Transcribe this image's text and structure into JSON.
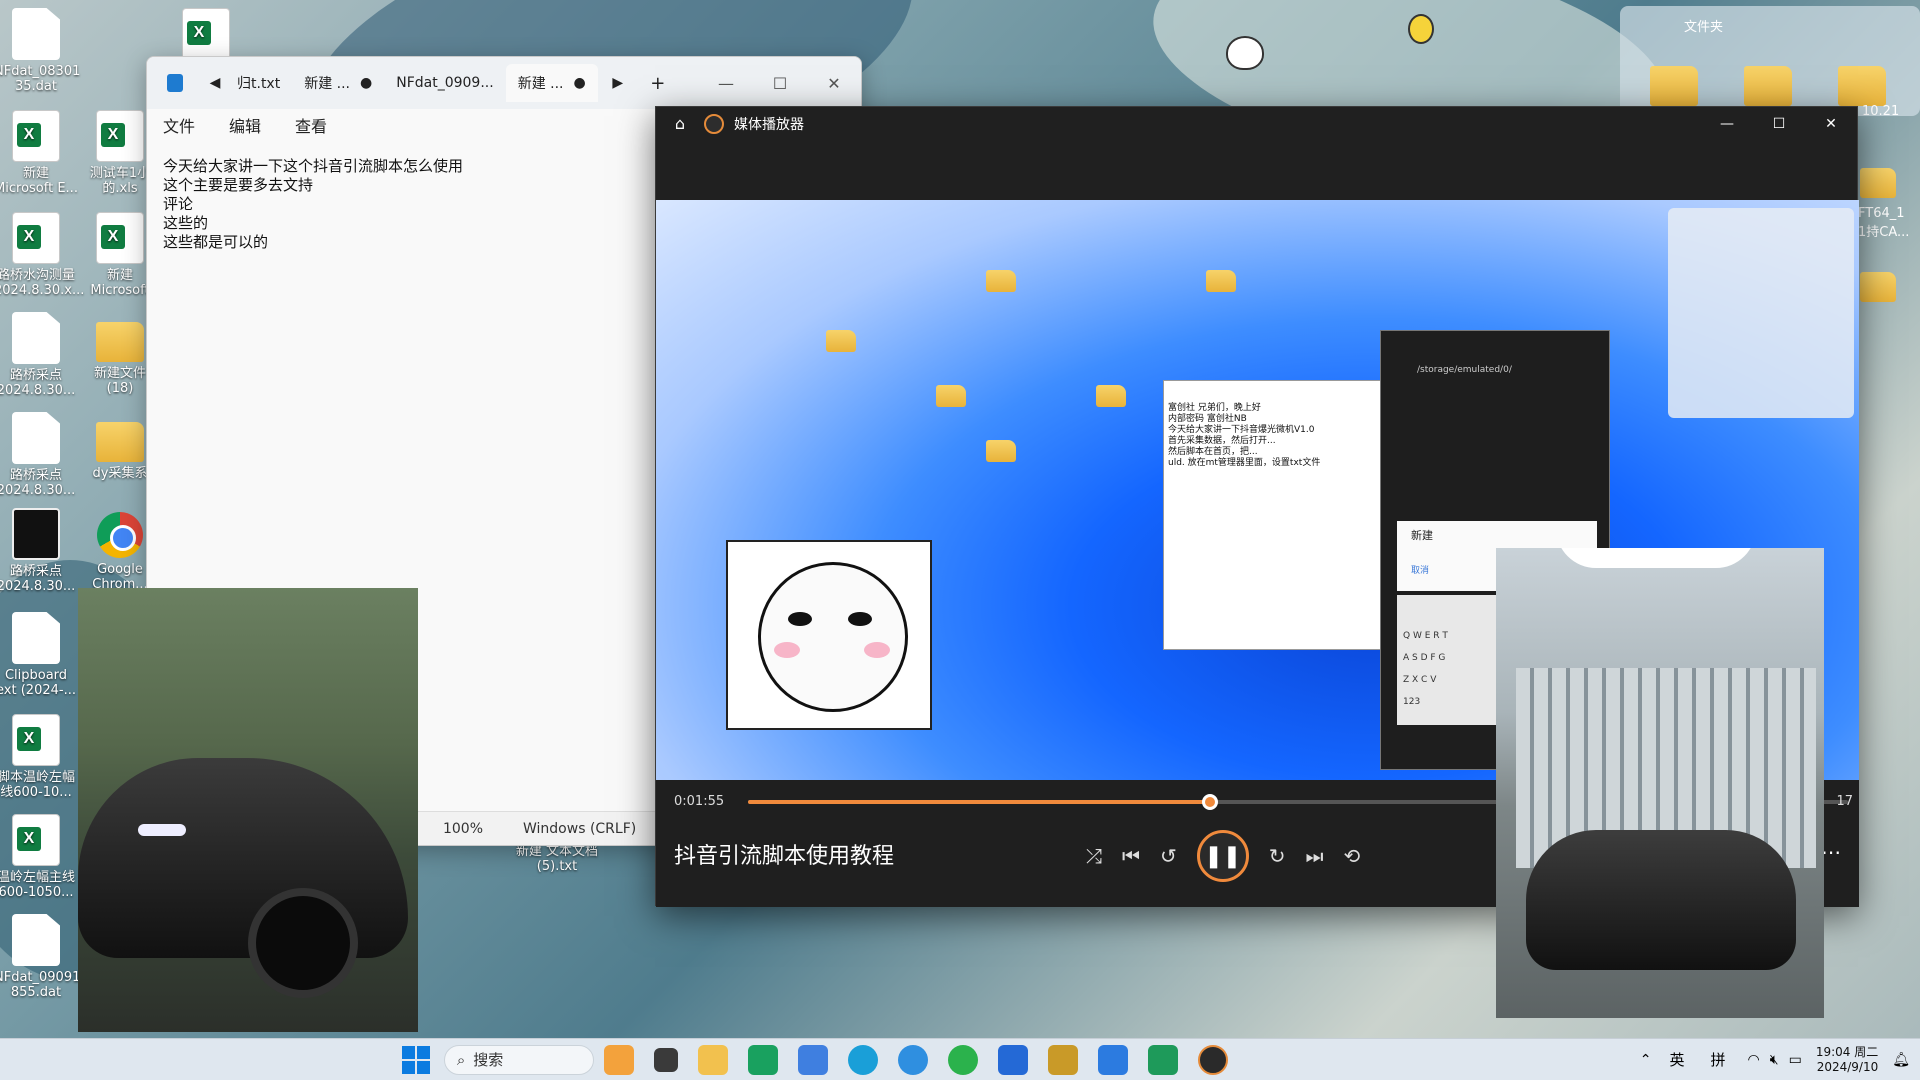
{
  "desktop": {
    "icons": [
      {
        "label": "NFdat_08301\n35.dat",
        "type": "file"
      },
      {
        "label": "新建\nMicrosoft E...",
        "type": "excel"
      },
      {
        "label": "测试车1小\n的.xls",
        "type": "excel"
      },
      {
        "label": "路桥水沟测量\n2024.8.30.x...",
        "type": "excel"
      },
      {
        "label": "新建\nMicrosoft",
        "type": "excel"
      },
      {
        "label": "路桥采点\n2024.8.30...",
        "type": "file"
      },
      {
        "label": "新建文件\n(18)",
        "type": "folder"
      },
      {
        "label": "路桥采点\n2024.8.30...",
        "type": "file"
      },
      {
        "label": "dy采集系",
        "type": "folder"
      },
      {
        "label": "路桥采点\n2024.8.30...",
        "type": "dark"
      },
      {
        "label": "Google\nChrom...",
        "type": "chrome"
      },
      {
        "label": "Clipboard\next (2024-...",
        "type": "file"
      },
      {
        "label": "脚本温岭左幅\n线600-10...",
        "type": "excel"
      },
      {
        "label": "温岭左幅主线\n600-1050...",
        "type": "excel"
      },
      {
        "label": "NFdat_09091\n855.dat",
        "type": "file"
      },
      {
        "label": "新建 文本文档\n(5).txt",
        "type": "file"
      }
    ],
    "top_right_explorer": {
      "title": "文件夹",
      "date_label": "10.21",
      "label2": "FT64_1\n1持CA..."
    }
  },
  "notepad": {
    "tabs": [
      "归t.txt",
      "新建 ...",
      "NFdat_0909...",
      "新建 ..."
    ],
    "active_tab": "新建 ...",
    "menu": [
      "文件",
      "编辑",
      "查看"
    ],
    "lines": [
      "今天给大家讲一下这个抖音引流脚本怎么使用",
      "这个主要是要多去文持",
      "评论",
      "这些的",
      "这些都是可以的"
    ],
    "zoom": "100%",
    "line_ending": "Windows (CRLF)"
  },
  "player": {
    "title": "媒体播放器",
    "current_time": "0:01:55",
    "end_time_partial": "17",
    "progress_fraction": 0.42,
    "track_title": "抖音引流脚本使用教程",
    "video": {
      "dialog_title": "新建",
      "dialog_cancel": "取消",
      "inner_notepad_lines": [
        "富创社 兄弟们，晚上好",
        "内部密码 富创社NB",
        "今天给大家讲一下抖音爆光微机V1.0",
        "首先采集数据，然后打开...",
        "然后脚本在首页，把...",
        "uld. 放在mt管理器里面，设置txt文件"
      ],
      "path": "/storage/emulated/0/",
      "keyboard_rows": [
        "Q W E R T",
        "A S D F G",
        "Z X C V"
      ],
      "keyboard_extra": "123"
    }
  },
  "taskbar": {
    "search_placeholder": "搜索",
    "ime_lang": "英",
    "ime_mode": "拼",
    "time": "19:04 周二",
    "date": "2024/9/10",
    "colors": {
      "accent": "#0067c0",
      "progress": "#f08a3c"
    }
  }
}
